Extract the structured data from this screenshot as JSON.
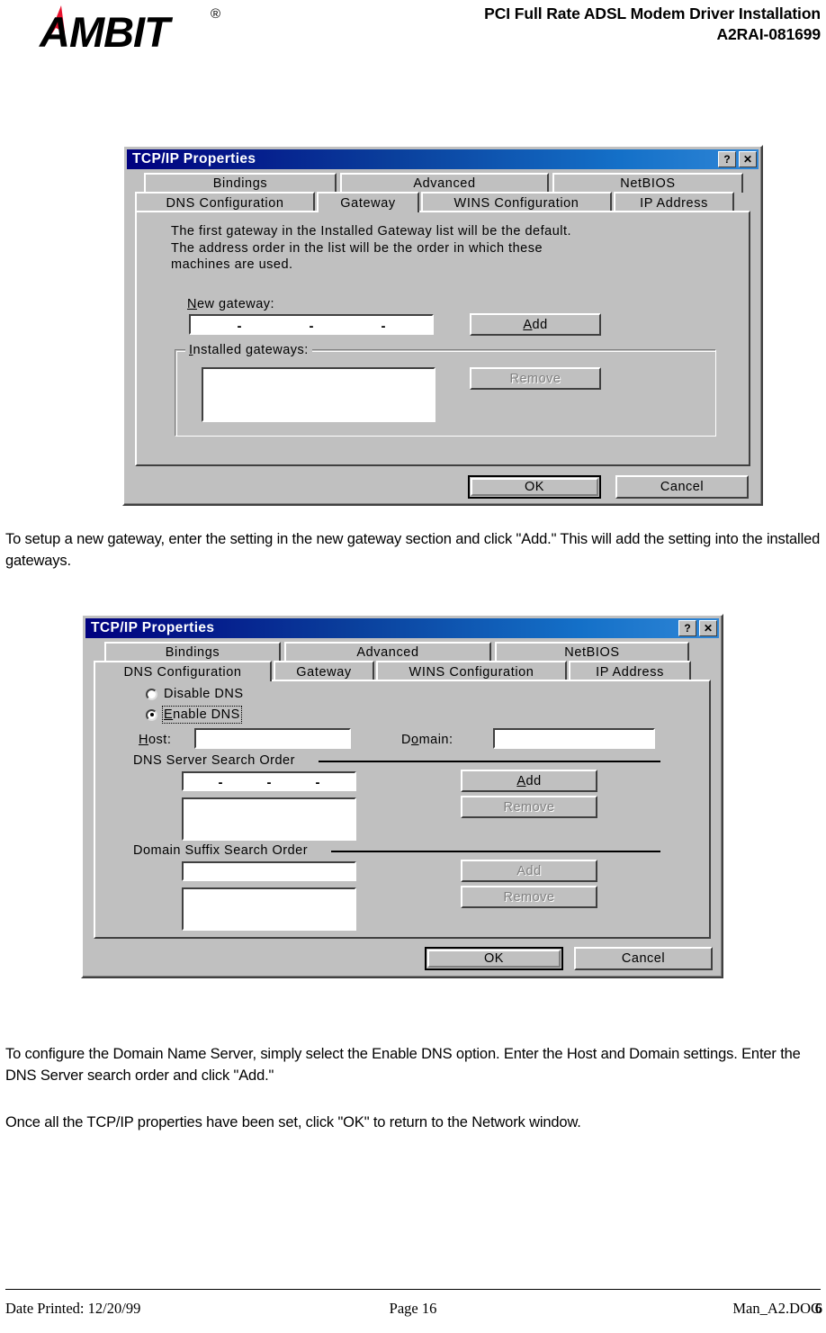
{
  "header": {
    "logo_text": "AMBIT",
    "logo_registered": "®",
    "title_line1": "PCI Full Rate ADSL Modem Driver Installation",
    "title_line2": "A2RAI-081699"
  },
  "dialog_gateway": {
    "title": "TCP/IP Properties",
    "title_buttons": [
      {
        "name": "help-button",
        "glyph": "?"
      },
      {
        "name": "close-button",
        "glyph": "✕"
      }
    ],
    "tabs_row1": [
      {
        "label": "Bindings",
        "active": false
      },
      {
        "label": "Advanced",
        "active": false
      },
      {
        "label": "NetBIOS",
        "active": false
      }
    ],
    "tabs_row2": [
      {
        "label": "DNS Configuration",
        "active": false
      },
      {
        "label": "Gateway",
        "active": true
      },
      {
        "label": "WINS Configuration",
        "active": false
      },
      {
        "label": "IP Address",
        "active": false
      }
    ],
    "help_text": "The first gateway in the Installed Gateway list will be the default.\nThe address order in the list will be the order in which these\nmachines are used.",
    "new_gateway_label": "New gateway:",
    "new_gateway_value": "",
    "ip_separator": "-",
    "add_button": "Add",
    "installed_group_title": "Installed gateways:",
    "installed_list_value": "",
    "remove_button": "Remove",
    "ok_button": "OK",
    "cancel_button": "Cancel"
  },
  "paragraph_gateway": "To setup a new gateway, enter the setting in the new gateway section and click \"Add.\"   This will add the setting into the installed gateways.",
  "dialog_dns": {
    "title": "TCP/IP Properties",
    "title_buttons": [
      {
        "name": "help-button",
        "glyph": "?"
      },
      {
        "name": "close-button",
        "glyph": "✕"
      }
    ],
    "tabs_row1": [
      {
        "label": "Bindings",
        "active": false
      },
      {
        "label": "Advanced",
        "active": false
      },
      {
        "label": "NetBIOS",
        "active": false
      }
    ],
    "tabs_row2": [
      {
        "label": "DNS Configuration",
        "active": true
      },
      {
        "label": "Gateway",
        "active": false
      },
      {
        "label": "WINS Configuration",
        "active": false
      },
      {
        "label": "IP Address",
        "active": false
      }
    ],
    "radio_disable": "Disable DNS",
    "radio_enable": "Enable DNS",
    "radio_selected": "Enable DNS",
    "host_label": "Host:",
    "host_value": "",
    "domain_label": "Domain:",
    "domain_value": "",
    "dns_group_title": "DNS Server Search Order",
    "dns_ip_value": "",
    "ip_separator": "-",
    "dns_add_button": "Add",
    "dns_remove_button": "Remove",
    "dns_list_value": "",
    "suffix_group_title": "Domain Suffix Search Order",
    "suffix_input_value": "",
    "suffix_add_button": "Add",
    "suffix_remove_button": "Remove",
    "suffix_list_value": "",
    "ok_button": "OK",
    "cancel_button": "Cancel"
  },
  "paragraph_dns": "To configure the Domain Name Server, simply select the Enable DNS option.  Enter the Host and Domain settings.  Enter the DNS Server search order and click \"Add.\"",
  "paragraph_ok": "Once all the TCP/IP properties have been set, click \"OK\" to return to the Network window.",
  "footer": {
    "date_printed": "Date Printed: 12/20/99",
    "page": "Page 16",
    "doc": "Man_A2.DOC",
    "doc_overlap": "6"
  },
  "colors": {
    "dialog_face": "#c0c0c0",
    "titlebar_start": "#00007f",
    "titlebar_end": "#2f86d6",
    "logo_accent": "#e8112d",
    "text": "#000000",
    "disabled_text": "#808080"
  }
}
